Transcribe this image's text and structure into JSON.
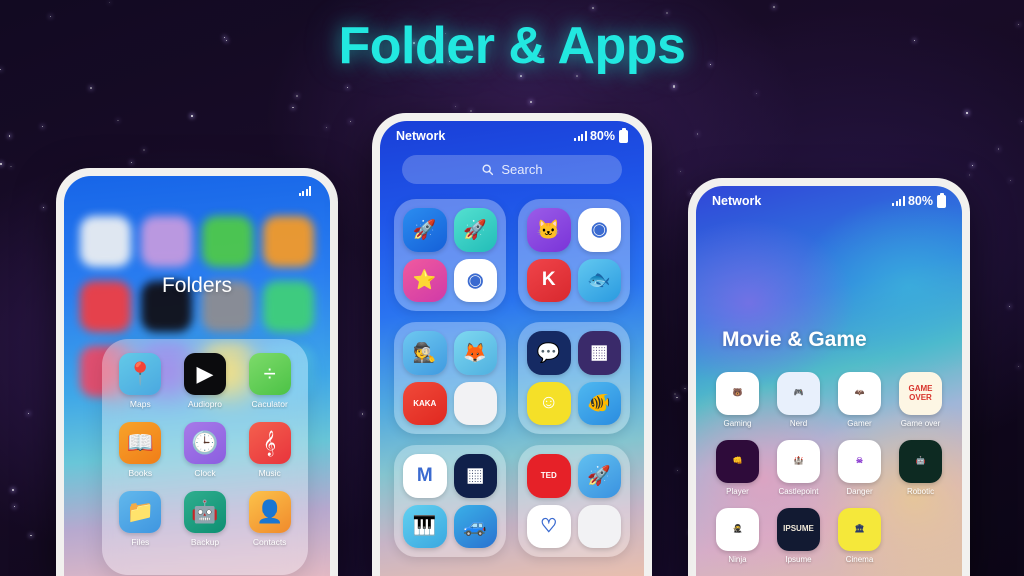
{
  "page": {
    "title": "Folder & Apps",
    "accent_color": "#22e8e0",
    "background_color": "#120a22"
  },
  "phone_left": {
    "name": "Folders phone",
    "status": {
      "carrier": "",
      "battery": "",
      "signal_icon": "signal-bars-icon",
      "battery_icon": "battery-icon"
    },
    "screen_title": "Folders",
    "folder_panel": {
      "apps": [
        {
          "label": "Maps",
          "icon": "maps-icon",
          "glyph": "📍",
          "bg": "linear-gradient(145deg,#63c9e8,#4aa8e0)"
        },
        {
          "label": "Audiopro",
          "icon": "audiopro-icon",
          "glyph": "▶",
          "bg": "#0b0b0d"
        },
        {
          "label": "Caculator",
          "icon": "calculator-icon",
          "glyph": "÷",
          "bg": "linear-gradient(145deg,#7ddb6a,#4cc246)"
        },
        {
          "label": "Books",
          "icon": "books-icon",
          "glyph": "📖",
          "bg": "linear-gradient(145deg,#f7a32a,#f07d18)"
        },
        {
          "label": "Clock",
          "icon": "clock-icon",
          "glyph": "🕒",
          "bg": "linear-gradient(145deg,#a77ae8,#8b5ee0)"
        },
        {
          "label": "Music",
          "icon": "music-icon",
          "glyph": "𝄞",
          "bg": "linear-gradient(145deg,#f4604e,#e8343c)"
        },
        {
          "label": "Files",
          "icon": "files-icon",
          "glyph": "📁",
          "bg": "linear-gradient(145deg,#62b8ec,#3f96e0)"
        },
        {
          "label": "Backup",
          "icon": "backup-icon",
          "glyph": "🤖",
          "bg": "linear-gradient(145deg,#2fae8e,#0e8f72)"
        },
        {
          "label": "Contacts",
          "icon": "contacts-icon",
          "glyph": "👤",
          "bg": "linear-gradient(145deg,#fcc24a,#f08a2c)"
        }
      ]
    },
    "blurred_wallpaper_icons": [
      {
        "icon": "blurred-app-1",
        "bg": "#eaeef2"
      },
      {
        "icon": "blurred-app-2",
        "bg": "#c39ae0"
      },
      {
        "icon": "blurred-app-3",
        "bg": "#4ec94a"
      },
      {
        "icon": "blurred-app-4",
        "bg": "#f39a2a"
      },
      {
        "icon": "blurred-app-5",
        "bg": "#ef3e44"
      },
      {
        "icon": "blurred-app-6",
        "bg": "#111018"
      },
      {
        "icon": "blurred-app-7",
        "bg": "#8d8d92"
      },
      {
        "icon": "blurred-app-8",
        "bg": "#3fcf7a"
      },
      {
        "icon": "blurred-app-9",
        "bg": "#e84b6a"
      },
      {
        "icon": "blurred-app-10",
        "bg": "#7a5ae0"
      },
      {
        "icon": "blurred-app-11",
        "bg": "#f0d24a"
      },
      {
        "icon": "blurred-app-12",
        "bg": "#4ab8ea"
      }
    ]
  },
  "phone_center": {
    "name": "Folder list phone",
    "status": {
      "carrier": "Network",
      "battery": "80%",
      "signal_icon": "signal-bars-icon",
      "battery_icon": "battery-icon"
    },
    "search": {
      "placeholder": "Search",
      "icon": "search-icon"
    },
    "folders": [
      {
        "name": "folder-rockets",
        "tiles": [
          {
            "icon": "rocket-blue-icon",
            "glyph": "🚀",
            "bg": "linear-gradient(145deg,#2b8df0,#1560d8)"
          },
          {
            "icon": "rocket-teal-icon",
            "glyph": "🚀",
            "bg": "linear-gradient(145deg,#54e0d0,#22bdb8)"
          },
          {
            "icon": "star-pink-icon",
            "glyph": "⭐",
            "bg": "linear-gradient(145deg,#f05a9e,#d03aa8)"
          },
          {
            "icon": "browser-icon",
            "glyph": "◉",
            "bg": "#ffffff"
          }
        ]
      },
      {
        "name": "folder-media",
        "tiles": [
          {
            "icon": "cat-purple-icon",
            "glyph": "🐱",
            "bg": "linear-gradient(145deg,#9b5ce8,#7a34d8)"
          },
          {
            "icon": "camera-2022-icon",
            "glyph": "◉",
            "bg": "#ffffff"
          },
          {
            "icon": "kinemaster-k-icon",
            "glyph": "K",
            "bg": "linear-gradient(145deg,#f0444a,#d8282e)"
          },
          {
            "icon": "fish-game-icon",
            "glyph": "🐟",
            "bg": "linear-gradient(145deg,#62c8f0,#2a9ae0)"
          }
        ]
      },
      {
        "name": "folder-kids",
        "tiles": [
          {
            "icon": "detective-icon",
            "glyph": "🕵",
            "bg": "linear-gradient(145deg,#6ec8f0,#3f9ae0)"
          },
          {
            "icon": "lingokids-icon",
            "glyph": "🦊",
            "bg": "linear-gradient(145deg,#7ed8f0,#4fb0e0)"
          },
          {
            "icon": "kaka-icon",
            "glyph": "KAKA",
            "bg": "linear-gradient(145deg,#f04a3a,#e02820)"
          },
          {
            "icon": "mixed-apps-icon",
            "glyph": "",
            "bg": "#f2f2f4"
          }
        ]
      },
      {
        "name": "folder-social",
        "tiles": [
          {
            "icon": "chat-p-icon",
            "glyph": "💬",
            "bg": "#152a63"
          },
          {
            "icon": "color-grid-icon",
            "glyph": "▦",
            "bg": "#3a2a6a"
          },
          {
            "icon": "smiley-icon",
            "glyph": "☺",
            "bg": "#f5e028"
          },
          {
            "icon": "songs-icon",
            "glyph": "🐠",
            "bg": "linear-gradient(145deg,#4fb8f0,#2a8ce0)"
          }
        ]
      },
      {
        "name": "folder-games",
        "tiles": [
          {
            "icon": "letter-m-icon",
            "glyph": "M",
            "bg": "#ffffff"
          },
          {
            "icon": "tetris-icon",
            "glyph": "▦",
            "bg": "#10204a"
          },
          {
            "icon": "piano-kids-icon",
            "glyph": "🎹",
            "bg": "linear-gradient(145deg,#62d0f0,#3aa8e0)"
          },
          {
            "icon": "monster-truck-icon",
            "glyph": "🚙",
            "bg": "linear-gradient(145deg,#3ab0e8,#2a72d0)"
          }
        ]
      },
      {
        "name": "folder-learning",
        "tiles": [
          {
            "icon": "ted-icon",
            "glyph": "TED",
            "bg": "#e62128"
          },
          {
            "icon": "rocket-kids-icon",
            "glyph": "🚀",
            "bg": "linear-gradient(145deg,#62c0f0,#3a92e0)"
          },
          {
            "icon": "heart-icon",
            "glyph": "♡",
            "bg": "#ffffff"
          },
          {
            "icon": "mixed-four-icon",
            "glyph": "",
            "bg": "#f2f2f4"
          }
        ]
      }
    ]
  },
  "phone_right": {
    "name": "Movie & Game phone",
    "status": {
      "carrier": "Network",
      "battery": "80%",
      "signal_icon": "signal-bars-icon",
      "battery_icon": "battery-icon"
    },
    "screen_title": "Movie & Game",
    "apps": [
      {
        "label": "Gaming",
        "icon": "gaming-bear-icon",
        "glyph": "🐻",
        "bg": "#ffffff",
        "fg": "#2d8a5a"
      },
      {
        "label": "Nerd",
        "icon": "nerd-gamepad-icon",
        "glyph": "🎮",
        "bg": "#e8f0fc",
        "fg": "#2a4ad0"
      },
      {
        "label": "Gamer",
        "icon": "gamer-bat-icon",
        "glyph": "🦇",
        "bg": "#ffffff",
        "fg": "#c4262e"
      },
      {
        "label": "Game over",
        "icon": "game-over-icon",
        "glyph": "GAME OVER",
        "bg": "#fdf6e4",
        "fg": "#d8342c"
      },
      {
        "label": "Player",
        "icon": "player-icon",
        "glyph": "👊",
        "bg": "#2e0b3a",
        "fg": "#f0c23a"
      },
      {
        "label": "Castlepoint",
        "icon": "castlepoint-icon",
        "glyph": "🏰",
        "bg": "#ffffff",
        "fg": "#d8385a"
      },
      {
        "label": "Danger",
        "icon": "danger-icon",
        "glyph": "☠",
        "bg": "#ffffff",
        "fg": "#8a3ad0"
      },
      {
        "label": "Robotic",
        "icon": "robotic-icon",
        "glyph": "🤖",
        "bg": "#0d2a22",
        "fg": "#3ae0b0"
      },
      {
        "label": "Ninja",
        "icon": "ninja-icon",
        "glyph": "🥷",
        "bg": "#ffffff",
        "fg": "#7a4ad0"
      },
      {
        "label": "Ipsume",
        "icon": "ipsume-icon",
        "glyph": "IPSUME",
        "bg": "#121a32",
        "fg": "#f0e8d8"
      },
      {
        "label": "Cinema",
        "icon": "cinema-icon",
        "glyph": "🏛",
        "bg": "#f5e83a",
        "fg": "#2a3a6a"
      }
    ]
  }
}
